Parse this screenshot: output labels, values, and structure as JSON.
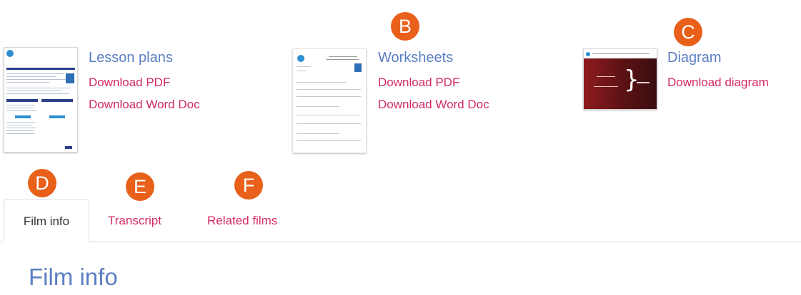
{
  "resources": [
    {
      "title": "Lesson plans",
      "links": [
        "Download PDF",
        "Download Word Doc"
      ]
    },
    {
      "title": "Worksheets",
      "links": [
        "Download PDF",
        "Download Word Doc"
      ]
    },
    {
      "title": "Diagram",
      "links": [
        "Download diagram"
      ]
    }
  ],
  "badges": [
    "B",
    "C",
    "D",
    "E",
    "F"
  ],
  "tabs": [
    "Film info",
    "Transcript",
    "Related films"
  ],
  "content": {
    "heading": "Film info"
  },
  "colors": {
    "link_title": "#5b7fc4",
    "link_download": "#d42a63",
    "badge": "#e8601a"
  }
}
